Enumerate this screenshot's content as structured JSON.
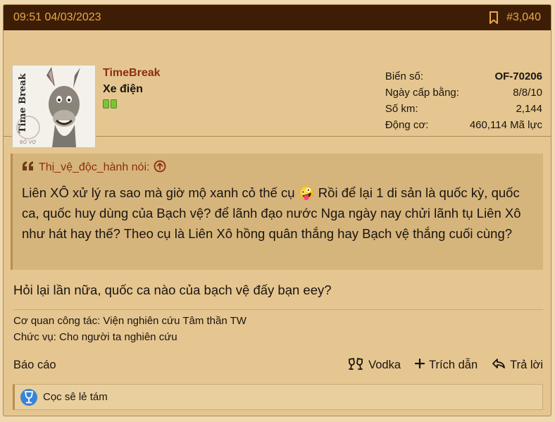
{
  "header": {
    "timestamp": "09:51 04/03/2023",
    "post_number": "#3,040"
  },
  "user": {
    "name": "TimeBreak",
    "title": "Xe điện",
    "avatar_caption": "Time Break",
    "avatar_stamp": "BỐ VỢ"
  },
  "stats": [
    {
      "label": "Biển số:",
      "value": "OF-70206"
    },
    {
      "label": "Ngày cấp bằng:",
      "value": "8/8/10"
    },
    {
      "label": "Số km:",
      "value": "2,144"
    },
    {
      "label": "Động cơ:",
      "value": "460,114 Mã lực"
    }
  ],
  "quote": {
    "author": "Thị_vệ_độc_hành nói:",
    "text": "Liên XÔ xử lý ra sao mà giờ mộ xanh cỏ thế cụ 🤪 Rồi để lại 1 di sản là quốc kỳ, quốc ca, quốc huy dùng của Bạch vệ? để lãnh đạo nước Nga ngày nay chửi lãnh tụ Liên Xô như hát hay thế? Theo cụ là Liên Xô hồng quân thắng hay Bạch vệ thắng cuối cùng?"
  },
  "reply": "Hỏi lại lần nữa, quốc ca nào của bạch vệ đấy bạn eey?",
  "signature": {
    "line1": "Cơ quan công tác: Viện nghiên cứu Tâm thần TW",
    "line2": "Chức vụ: Cho người ta nghiên cứu"
  },
  "actions": {
    "report": "Báo cáo",
    "react": "Vodka",
    "quote": "Trích dẫn",
    "reply": "Trả lời"
  },
  "reactions": {
    "summary": "Cọc sê lẻ tám"
  },
  "colors": {
    "header_bg": "#3d1d05",
    "accent": "#e9a84a",
    "username": "#8c2e12",
    "post_bg": "#e5c690"
  }
}
